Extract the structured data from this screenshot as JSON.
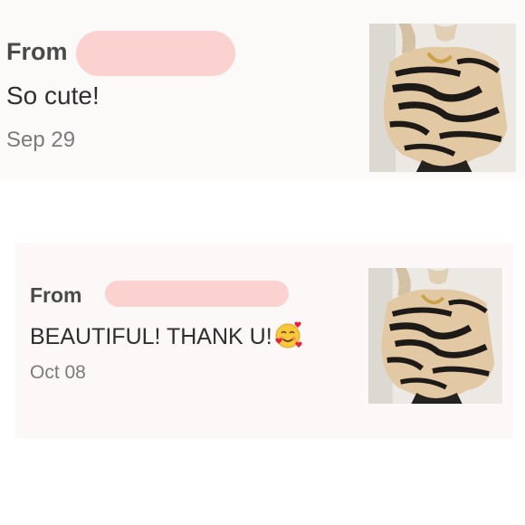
{
  "reviews": [
    {
      "from_label": "From",
      "message": "So cute!",
      "date": "Sep 29",
      "thumbnail_icon": "zebra-print-sweater-photo"
    },
    {
      "from_label": "From",
      "message": "BEAUTIFUL! THANK U!",
      "emoji": "smiling-face-with-hearts",
      "date": "Oct 08",
      "thumbnail_icon": "zebra-print-sweater-photo"
    }
  ],
  "colors": {
    "card_bg": "#fcf9f9",
    "redaction": "#fcd2d0",
    "label": "#4a4a4a",
    "date": "#7b7b7b"
  }
}
